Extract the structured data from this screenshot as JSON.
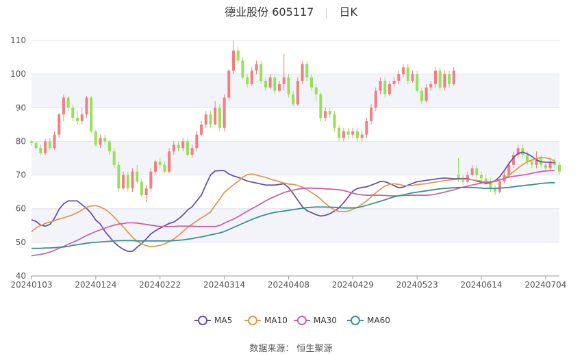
{
  "header": {
    "stock_name": "德业股份 605117",
    "period": "日K"
  },
  "footer": {
    "source": "数据来源：  恒生聚源"
  },
  "colors": {
    "up": "#f08080",
    "down": "#99e05a",
    "MA5": "#6b4fa8",
    "MA10": "#e09a50",
    "MA30": "#d060a8",
    "MA60": "#3a9090"
  },
  "chart_data": {
    "type": "candlestick",
    "ylim": [
      40,
      110
    ],
    "yticks": [
      40,
      50,
      60,
      70,
      80,
      90,
      100,
      110
    ],
    "xticks": [
      "20240103",
      "20240124",
      "20240222",
      "20240314",
      "20240408",
      "20240429",
      "20240523",
      "20240614",
      "20240704"
    ],
    "xtick_index": [
      0,
      14,
      28,
      42,
      56,
      70,
      84,
      98,
      112
    ],
    "legend": [
      "MA5",
      "MA10",
      "MA30",
      "MA60"
    ],
    "legend_position": "bottom",
    "grid": "horizontal bands",
    "candles": [
      [
        80,
        79.5,
        80.5,
        78.8
      ],
      [
        79.5,
        78,
        80,
        77.5
      ],
      [
        78,
        76.5,
        79,
        76
      ],
      [
        76.5,
        80,
        80.8,
        76
      ],
      [
        80,
        78,
        81,
        77.5
      ],
      [
        78,
        82,
        83,
        77.5
      ],
      [
        82,
        88,
        88.5,
        81
      ],
      [
        88,
        93,
        94,
        86
      ],
      [
        93,
        90,
        93.5,
        89
      ],
      [
        90,
        87,
        91,
        86
      ],
      [
        87,
        86,
        89,
        85
      ],
      [
        86,
        88,
        90,
        85
      ],
      [
        88,
        93,
        93.5,
        87
      ],
      [
        93,
        83,
        93.5,
        82.5
      ],
      [
        83,
        79,
        83.5,
        78.5
      ],
      [
        79,
        81,
        82,
        78
      ],
      [
        81,
        80,
        82,
        79
      ],
      [
        80,
        77,
        80.5,
        76
      ],
      [
        77,
        73,
        78,
        72
      ],
      [
        73,
        66,
        74,
        65
      ],
      [
        66,
        70,
        71,
        65.5
      ],
      [
        70,
        66,
        71,
        65
      ],
      [
        66,
        71,
        72,
        65
      ],
      [
        71,
        68,
        73,
        67.5
      ],
      [
        68,
        64,
        69,
        63.5
      ],
      [
        64,
        66,
        67,
        62
      ],
      [
        66,
        71,
        72,
        65
      ],
      [
        71,
        74,
        74.5,
        70
      ],
      [
        74,
        73,
        75,
        72
      ],
      [
        73,
        71,
        74,
        70.5
      ],
      [
        71,
        77,
        78,
        70.5
      ],
      [
        77,
        79,
        80,
        76
      ],
      [
        79,
        78,
        80,
        77
      ],
      [
        78,
        80,
        81,
        77
      ],
      [
        80,
        76,
        81,
        75.5
      ],
      [
        76,
        78,
        79,
        75
      ],
      [
        78,
        82,
        83,
        77
      ],
      [
        82,
        85,
        86,
        81.5
      ],
      [
        85,
        88,
        89,
        84
      ],
      [
        88,
        85,
        89,
        84
      ],
      [
        85,
        90,
        92,
        85
      ],
      [
        90,
        84,
        91,
        83
      ],
      [
        84,
        93,
        94,
        83
      ],
      [
        93,
        101,
        101.5,
        92
      ],
      [
        101,
        107,
        110,
        100
      ],
      [
        107,
        104,
        108,
        103
      ],
      [
        104,
        99,
        105,
        98.5
      ],
      [
        99,
        97,
        100,
        96
      ],
      [
        97,
        101,
        102,
        96.5
      ],
      [
        101,
        103,
        104,
        100
      ],
      [
        103,
        98,
        104,
        97
      ],
      [
        98,
        96,
        99,
        95
      ],
      [
        96,
        99,
        100,
        95.5
      ],
      [
        99,
        95,
        100,
        94
      ],
      [
        95,
        97,
        98,
        94.5
      ],
      [
        97,
        99,
        106,
        95
      ],
      [
        99,
        94,
        100,
        93
      ],
      [
        94,
        91,
        95,
        90.5
      ],
      [
        91,
        98,
        99,
        90.5
      ],
      [
        98,
        103,
        104,
        97
      ],
      [
        103,
        99,
        104,
        98
      ],
      [
        99,
        96,
        100,
        95
      ],
      [
        96,
        94,
        97,
        92
      ],
      [
        94,
        87,
        94.5,
        86
      ],
      [
        87,
        89,
        90,
        86
      ],
      [
        89,
        88,
        90,
        87
      ],
      [
        88,
        84,
        89,
        83
      ],
      [
        84,
        81,
        85,
        80
      ],
      [
        81,
        83,
        84,
        80
      ],
      [
        83,
        82,
        84,
        80.5
      ],
      [
        82,
        83,
        84,
        81
      ],
      [
        83,
        81,
        84,
        80
      ],
      [
        81,
        82,
        83,
        80
      ],
      [
        82,
        86,
        87,
        81
      ],
      [
        86,
        90,
        91,
        85
      ],
      [
        90,
        95,
        96,
        89
      ],
      [
        95,
        98,
        99,
        94
      ],
      [
        98,
        94,
        99,
        93
      ],
      [
        94,
        97,
        98,
        93.5
      ],
      [
        97,
        98,
        99,
        96
      ],
      [
        98,
        100,
        101,
        97
      ],
      [
        100,
        102,
        103,
        99
      ],
      [
        102,
        98,
        103,
        97
      ],
      [
        98,
        100,
        101,
        97.5
      ],
      [
        100,
        95,
        101,
        94.5
      ],
      [
        95,
        92,
        96,
        91
      ],
      [
        92,
        96,
        97,
        91.5
      ],
      [
        96,
        97,
        98,
        95
      ],
      [
        97,
        101,
        102,
        96
      ],
      [
        101,
        96,
        102,
        95
      ],
      [
        96,
        100,
        101,
        95
      ],
      [
        100,
        97,
        101,
        96
      ],
      [
        97,
        101,
        102,
        96.5
      ],
      [
        70,
        69,
        75,
        68
      ],
      [
        69,
        68,
        70,
        67
      ],
      [
        68,
        70,
        71,
        67.5
      ],
      [
        70,
        72,
        73,
        69.5
      ],
      [
        72,
        70,
        73,
        69
      ],
      [
        70,
        69,
        71,
        68
      ],
      [
        69,
        68,
        70,
        67
      ],
      [
        68,
        66,
        69,
        65
      ],
      [
        66,
        65,
        67,
        64
      ],
      [
        65,
        68,
        69,
        64.5
      ],
      [
        68,
        70,
        71,
        67.5
      ],
      [
        70,
        73,
        74,
        69
      ],
      [
        73,
        76,
        77,
        72
      ],
      [
        76,
        78,
        79,
        75
      ],
      [
        78,
        76,
        79,
        75
      ],
      [
        76,
        74,
        77,
        73
      ],
      [
        74,
        73,
        75,
        72
      ],
      [
        73,
        75,
        77,
        72
      ],
      [
        75,
        73,
        76,
        72
      ],
      [
        73,
        72,
        74,
        71
      ],
      [
        72,
        74,
        75,
        71
      ],
      [
        74,
        73,
        75,
        72
      ],
      [
        73,
        71,
        74,
        70
      ]
    ],
    "series": [
      {
        "name": "MA5",
        "values": [
          56.7,
          56.2,
          55.1,
          54.8,
          55.3,
          57.1,
          59.8,
          61.4,
          62.3,
          62.3,
          62.3,
          61.2,
          60.1,
          58.6,
          56.6,
          55.4,
          53.2,
          51.6,
          50.0,
          48.8,
          47.9,
          47.3,
          47.3,
          48.5,
          49.6,
          51.0,
          52.5,
          53.4,
          54.2,
          54.9,
          55.6,
          56.0,
          56.9,
          58.1,
          59.6,
          60.6,
          62.3,
          64.0,
          67.1,
          70.0,
          71.2,
          71.3,
          71.3,
          70.3,
          69.7,
          69.3,
          68.8,
          68.2,
          67.9,
          67.6,
          67.3,
          67.0,
          67.0,
          67.0,
          67.2,
          67.4,
          66.3,
          64.5,
          62.5,
          60.6,
          59.4,
          58.8,
          58.2,
          57.8,
          58.0,
          58.5,
          59.3,
          60.3,
          61.8,
          63.5,
          65.2,
          66.0,
          66.3,
          66.5,
          67.0,
          67.5,
          68.1,
          68.0,
          67.5,
          66.8,
          66.2,
          66.4,
          67.0,
          67.5,
          68.0,
          68.2,
          68.4,
          68.6,
          68.8,
          69.0,
          69.1,
          69.0,
          68.9,
          68.9,
          69.0,
          68.9,
          68.6,
          68.2,
          67.8,
          67.5,
          67.7,
          68.3,
          69.5,
          71.3,
          73.4,
          75.2,
          76.4,
          76.8,
          76.3,
          75.5,
          74.5,
          73.9,
          73.8,
          73.8,
          73.6
        ]
      },
      {
        "name": "MA10",
        "values": [
          53.1,
          54.3,
          55.0,
          55.6,
          56.0,
          56.4,
          56.9,
          57.3,
          57.7,
          58.2,
          58.8,
          59.6,
          60.4,
          60.8,
          60.9,
          60.5,
          59.8,
          58.8,
          57.5,
          56.0,
          54.6,
          53.0,
          51.5,
          50.3,
          49.5,
          49.0,
          48.7,
          48.8,
          49.1,
          49.5,
          50.2,
          51.0,
          52.0,
          53.2,
          54.4,
          55.4,
          56.3,
          57.3,
          58.1,
          59.0,
          61.0,
          62.9,
          64.8,
          66.0,
          67.1,
          68.1,
          69.3,
          70.1,
          70.3,
          70.0,
          69.6,
          69.3,
          68.8,
          68.4,
          68.0,
          67.6,
          67.3,
          67.2,
          66.9,
          66.4,
          65.7,
          64.8,
          63.9,
          62.8,
          61.6,
          60.5,
          59.6,
          59.2,
          59.1,
          59.3,
          59.8,
          60.4,
          61.3,
          62.3,
          63.5,
          64.7,
          65.8,
          66.7,
          67.2,
          67.4,
          67.2,
          66.9,
          66.8,
          66.9,
          67.1,
          67.3,
          67.4,
          67.7,
          67.9,
          68.1,
          68.3,
          68.5,
          68.6,
          68.7,
          68.8,
          68.7,
          68.6,
          68.4,
          68.2,
          68.0,
          67.9,
          68.0,
          68.4,
          69.0,
          69.9,
          71.0,
          72.1,
          73.1,
          73.9,
          74.4,
          74.9,
          75.2,
          75.1,
          74.8,
          74.1
        ]
      },
      {
        "name": "MA30",
        "values": [
          46.0,
          46.2,
          46.4,
          46.7,
          47.1,
          47.6,
          48.2,
          48.8,
          49.4,
          50.0,
          50.6,
          51.3,
          52.0,
          52.6,
          53.2,
          53.7,
          54.2,
          54.7,
          55.1,
          55.4,
          55.6,
          55.8,
          55.8,
          55.7,
          55.5,
          55.3,
          55.1,
          54.9,
          54.7,
          54.7,
          54.7,
          54.7,
          54.8,
          54.8,
          54.8,
          54.8,
          54.7,
          54.7,
          54.7,
          54.7,
          54.7,
          55.0,
          55.7,
          56.3,
          56.9,
          57.6,
          58.4,
          59.2,
          60.0,
          60.7,
          61.5,
          62.3,
          63.0,
          63.6,
          64.2,
          64.8,
          65.2,
          65.5,
          65.8,
          66.0,
          66.1,
          66.1,
          66.0,
          66.0,
          65.9,
          65.8,
          65.7,
          65.6,
          65.4,
          65.0,
          64.6,
          64.3,
          64.1,
          64.0,
          64.0,
          64.0,
          64.0,
          63.9,
          63.8,
          63.8,
          63.8,
          63.9,
          63.9,
          64.0,
          64.0,
          64.0,
          64.0,
          64.1,
          64.3,
          64.6,
          64.9,
          65.3,
          65.6,
          66.0,
          66.4,
          66.7,
          67.0,
          67.3,
          67.6,
          67.8,
          68.0,
          68.3,
          68.6,
          69.0,
          69.4,
          69.6,
          69.8,
          70.0,
          70.2,
          70.5,
          70.8,
          71.0,
          71.2,
          71.3,
          71.3
        ]
      },
      {
        "name": "MA60",
        "values": [
          48.2,
          48.2,
          48.2,
          48.3,
          48.3,
          48.4,
          48.5,
          48.6,
          48.8,
          49.1,
          49.3,
          49.5,
          49.7,
          49.9,
          50.0,
          50.1,
          50.2,
          50.3,
          50.4,
          50.5,
          50.5,
          50.5,
          50.5,
          50.4,
          50.4,
          50.4,
          50.4,
          50.4,
          50.4,
          50.4,
          50.4,
          50.5,
          50.6,
          50.7,
          50.9,
          51.1,
          51.4,
          51.6,
          51.9,
          52.2,
          52.5,
          52.8,
          53.2,
          53.8,
          54.4,
          55.0,
          55.6,
          56.2,
          56.8,
          57.3,
          57.8,
          58.2,
          58.6,
          58.9,
          59.1,
          59.3,
          59.5,
          59.7,
          59.9,
          60.1,
          60.3,
          60.4,
          60.5,
          60.5,
          60.5,
          60.4,
          60.4,
          60.3,
          60.2,
          60.2,
          60.2,
          60.3,
          60.6,
          61.0,
          61.4,
          61.8,
          62.2,
          62.6,
          63.1,
          63.5,
          63.8,
          64.1,
          64.4,
          64.7,
          64.9,
          65.1,
          65.3,
          65.5,
          65.7,
          65.9,
          66.0,
          66.1,
          66.2,
          66.3,
          66.3,
          66.3,
          66.3,
          66.2,
          66.1,
          66.0,
          66.0,
          66.0,
          66.1,
          66.2,
          66.3,
          66.5,
          66.7,
          66.8,
          67.0,
          67.1,
          67.3,
          67.5,
          67.6,
          67.7,
          67.7
        ]
      }
    ]
  }
}
